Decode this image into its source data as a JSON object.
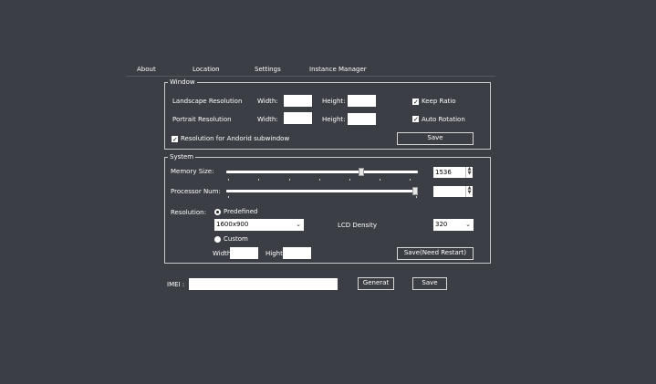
{
  "tabs": [
    "About",
    "Location",
    "Settings",
    "Instance Manager"
  ],
  "window": {
    "legend": "Window",
    "landscape_label": "Landscape Resolution",
    "portrait_label": "Portrait Resolution",
    "width_label": "Width:",
    "height_label": "Height:",
    "landscape_width": "",
    "landscape_height": "",
    "portrait_width": "",
    "portrait_height": "",
    "keep_ratio_label": "Keep Ratio",
    "keep_ratio_checked": true,
    "auto_rotation_label": "Auto Rotation",
    "auto_rotation_checked": true,
    "subwindow_label": "Resolution for Andorid subwindow",
    "subwindow_checked": true,
    "save_label": "Save"
  },
  "system": {
    "legend": "System",
    "memory_label": "Memory Size:",
    "memory_value": "1536",
    "memory_slider_fraction": 0.71,
    "processor_label": "Processor Num:",
    "processor_value": "",
    "processor_slider_fraction": 1.0,
    "resolution_label": "Resolution:",
    "predefined_label": "Predefined",
    "predefined_selected": true,
    "resolution_value": "1600x900",
    "lcd_label": "LCD Density",
    "lcd_value": "320",
    "custom_label": "Custom",
    "custom_width_label": "Width",
    "custom_height_label": "Hight",
    "save_restart_label": "Save(Need Restart)"
  },
  "imei": {
    "label": "IMEI :",
    "value": "",
    "generate_label": "Generat",
    "save_label": "Save"
  },
  "colors": {
    "background": "#3b3e44",
    "text": "#ffffff",
    "border": "#c9cacc"
  }
}
